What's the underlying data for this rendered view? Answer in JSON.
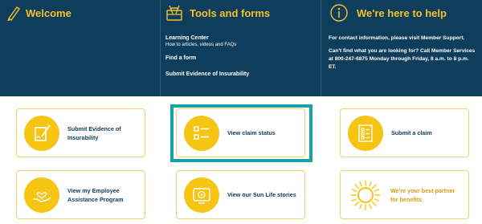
{
  "banner": {
    "welcome": {
      "title": "Welcome",
      "icon": "pen-icon"
    },
    "tools": {
      "title": "Tools and forms",
      "icon": "toolbox-icon",
      "learning_center": "Learning Center",
      "learning_center_sub": "How to articles, videos and FAQs",
      "find_form": "Find a form",
      "submit_eoi": "Submit Evidence of Insurability"
    },
    "help": {
      "title": "We're here to help",
      "icon": "info-icon",
      "para1": "For contact information, please visit Member Support.",
      "para2": "Can't find what you are looking for? Call Member Services at 800-247-6875 Monday through Friday, 8 a.m. to 8 p.m. ET."
    }
  },
  "cards": {
    "evidence": "Submit Evidence of Insurability",
    "claim_status": "View claim status",
    "submit_claim": "Submit a claim",
    "eap": "View my Employee Assistance Program",
    "stories": "View our Sun Life stories",
    "partner": "We're your best partner for benefits"
  },
  "colors": {
    "navy": "#0f3d5c",
    "gold": "#f6c413",
    "teal_focus": "#16a3a6"
  }
}
